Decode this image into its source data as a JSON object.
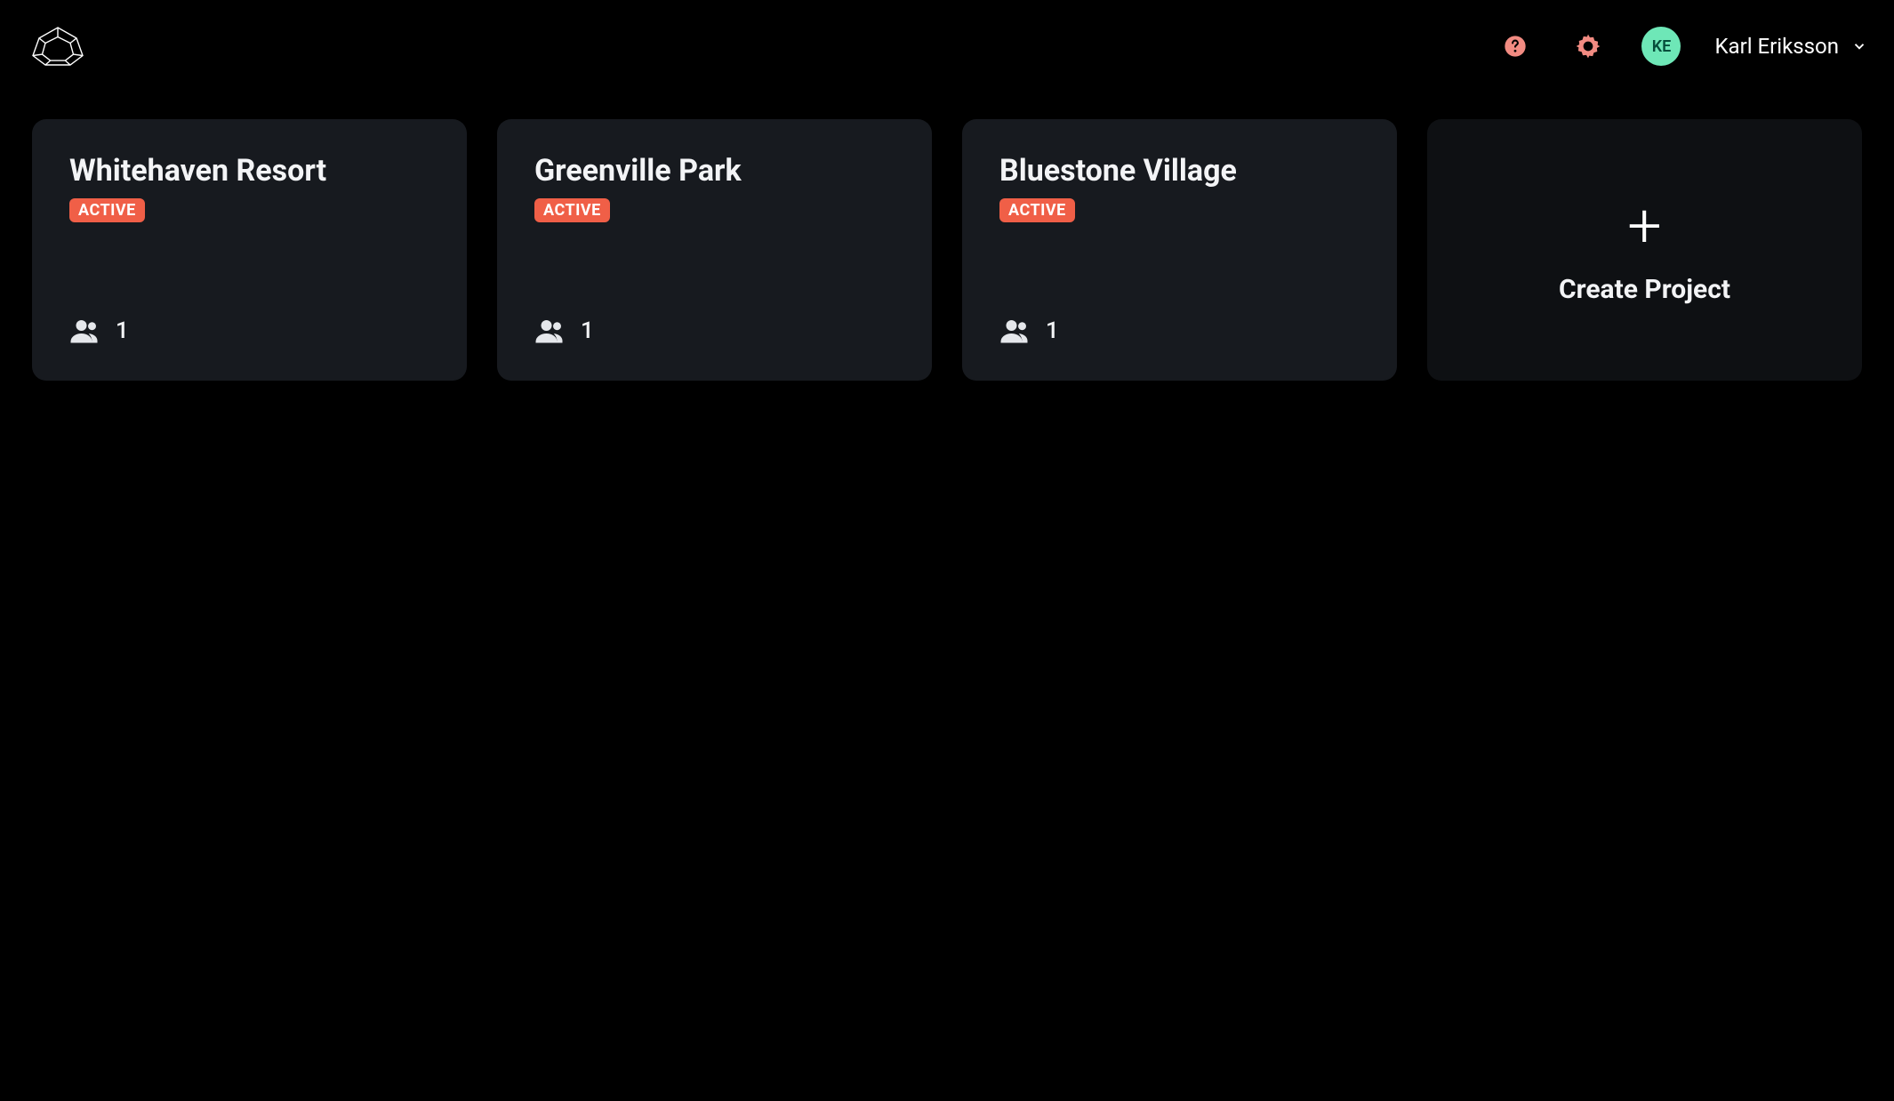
{
  "header": {
    "user_initials": "KE",
    "user_name": "Karl Eriksson"
  },
  "projects": [
    {
      "title": "Whitehaven Resort",
      "status": "ACTIVE",
      "members": "1"
    },
    {
      "title": "Greenville Park",
      "status": "ACTIVE",
      "members": "1"
    },
    {
      "title": "Bluestone Village",
      "status": "ACTIVE",
      "members": "1"
    }
  ],
  "create_project_label": "Create Project",
  "colors": {
    "badge_bg": "#f05f47",
    "avatar_bg": "#6ee7b7",
    "card_bg": "#171a1f"
  }
}
